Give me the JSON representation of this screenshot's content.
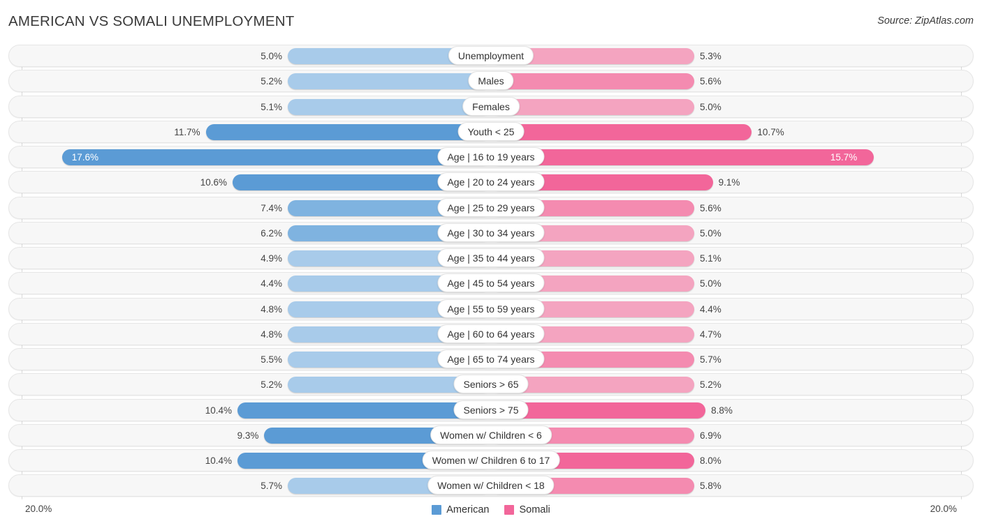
{
  "header": {
    "title": "AMERICAN VS SOMALI UNEMPLOYMENT",
    "source": "Source: ZipAtlas.com"
  },
  "axis": {
    "left_label": "20.0%",
    "right_label": "20.0%",
    "max": 20.0
  },
  "legend": [
    {
      "label": "American",
      "color": "#5B9BD5"
    },
    {
      "label": "Somali",
      "color": "#F2669A"
    }
  ],
  "colors": {
    "american_light": "#A8CBEA",
    "american_dark": "#5B9BD5",
    "somali_light": "#F4A4C0",
    "somali_dark": "#F2669A",
    "track": "#f7f7f7",
    "gridline": "#d9d9d9"
  },
  "chart_data": {
    "type": "bar",
    "subtype": "diverging-bidirectional",
    "title": "AMERICAN VS SOMALI UNEMPLOYMENT",
    "xlabel": "",
    "ylabel": "",
    "xlim": [
      20.0,
      20.0
    ],
    "grid": true,
    "legend_position": "bottom-center",
    "categories": [
      "Unemployment",
      "Males",
      "Females",
      "Youth < 25",
      "Age | 16 to 19 years",
      "Age | 20 to 24 years",
      "Age | 25 to 29 years",
      "Age | 30 to 34 years",
      "Age | 35 to 44 years",
      "Age | 45 to 54 years",
      "Age | 55 to 59 years",
      "Age | 60 to 64 years",
      "Age | 65 to 74 years",
      "Seniors > 65",
      "Seniors > 75",
      "Women w/ Children < 6",
      "Women w/ Children 6 to 17",
      "Women w/ Children < 18"
    ],
    "series": [
      {
        "name": "American",
        "side": "left",
        "values": [
          5.0,
          5.2,
          5.1,
          11.7,
          17.6,
          10.6,
          7.4,
          6.2,
          4.9,
          4.4,
          4.8,
          4.8,
          5.5,
          5.2,
          10.4,
          9.3,
          10.4,
          5.7
        ]
      },
      {
        "name": "Somali",
        "side": "right",
        "values": [
          5.3,
          5.6,
          5.0,
          10.7,
          15.7,
          9.1,
          5.6,
          5.0,
          5.1,
          5.0,
          4.4,
          4.7,
          5.7,
          5.2,
          8.8,
          6.9,
          8.0,
          5.8
        ]
      }
    ],
    "rows": [
      {
        "label": "Unemployment",
        "american": 5.0,
        "american_text": "5.0%",
        "somali": 5.3,
        "somali_text": "5.3%"
      },
      {
        "label": "Males",
        "american": 5.2,
        "american_text": "5.2%",
        "somali": 5.6,
        "somali_text": "5.6%"
      },
      {
        "label": "Females",
        "american": 5.1,
        "american_text": "5.1%",
        "somali": 5.0,
        "somali_text": "5.0%"
      },
      {
        "label": "Youth < 25",
        "american": 11.7,
        "american_text": "11.7%",
        "somali": 10.7,
        "somali_text": "10.7%"
      },
      {
        "label": "Age | 16 to 19 years",
        "american": 17.6,
        "american_text": "17.6%",
        "somali": 15.7,
        "somali_text": "15.7%"
      },
      {
        "label": "Age | 20 to 24 years",
        "american": 10.6,
        "american_text": "10.6%",
        "somali": 9.1,
        "somali_text": "9.1%"
      },
      {
        "label": "Age | 25 to 29 years",
        "american": 7.4,
        "american_text": "7.4%",
        "somali": 5.6,
        "somali_text": "5.6%"
      },
      {
        "label": "Age | 30 to 34 years",
        "american": 6.2,
        "american_text": "6.2%",
        "somali": 5.0,
        "somali_text": "5.0%"
      },
      {
        "label": "Age | 35 to 44 years",
        "american": 4.9,
        "american_text": "4.9%",
        "somali": 5.1,
        "somali_text": "5.1%"
      },
      {
        "label": "Age | 45 to 54 years",
        "american": 4.4,
        "american_text": "4.4%",
        "somali": 5.0,
        "somali_text": "5.0%"
      },
      {
        "label": "Age | 55 to 59 years",
        "american": 4.8,
        "american_text": "4.8%",
        "somali": 4.4,
        "somali_text": "4.4%"
      },
      {
        "label": "Age | 60 to 64 years",
        "american": 4.8,
        "american_text": "4.8%",
        "somali": 4.7,
        "somali_text": "4.7%"
      },
      {
        "label": "Age | 65 to 74 years",
        "american": 5.5,
        "american_text": "5.5%",
        "somali": 5.7,
        "somali_text": "5.7%"
      },
      {
        "label": "Seniors > 65",
        "american": 5.2,
        "american_text": "5.2%",
        "somali": 5.2,
        "somali_text": "5.2%"
      },
      {
        "label": "Seniors > 75",
        "american": 10.4,
        "american_text": "10.4%",
        "somali": 8.8,
        "somali_text": "8.8%"
      },
      {
        "label": "Women w/ Children < 6",
        "american": 9.3,
        "american_text": "9.3%",
        "somali": 6.9,
        "somali_text": "6.9%"
      },
      {
        "label": "Women w/ Children 6 to 17",
        "american": 10.4,
        "american_text": "10.4%",
        "somali": 8.0,
        "somali_text": "8.0%"
      },
      {
        "label": "Women w/ Children < 18",
        "american": 5.7,
        "american_text": "5.7%",
        "somali": 5.8,
        "somali_text": "5.8%"
      }
    ]
  }
}
